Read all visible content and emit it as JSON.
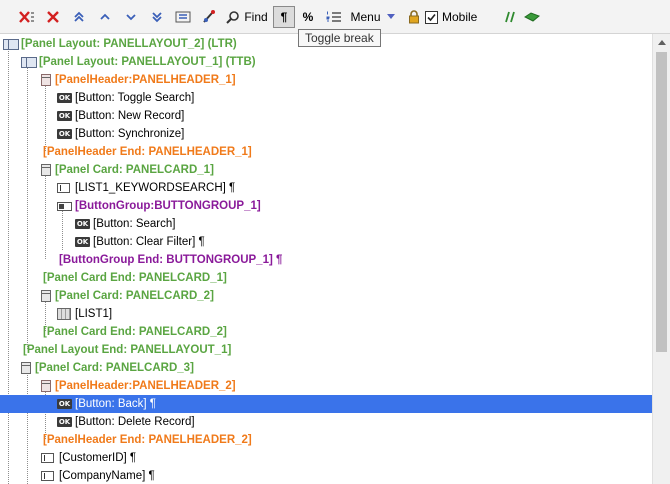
{
  "toolbar": {
    "find_label": "Find",
    "pilcrow_label": "¶",
    "percent_label": "%",
    "menu_label": "Menu",
    "mobile_label": "Mobile",
    "mobile_checked": true,
    "tooltip": "Toggle break"
  },
  "tree": {
    "rows": [
      {
        "text": "[Panel Layout: PANELLAYOUT_2] (LTR)",
        "color": "green",
        "icon": "layout-icon"
      },
      {
        "text": "[Panel Layout: PANELLAYOUT_1] (TTB)",
        "color": "green",
        "icon": "layout-icon"
      },
      {
        "text": "[PanelHeader:PANELHEADER_1]",
        "color": "orange",
        "icon": "panel-icon"
      },
      {
        "text": "[Button: Toggle Search]",
        "color": "black",
        "icon": "ok-button-icon"
      },
      {
        "text": "[Button: New Record]",
        "color": "black",
        "icon": "ok-button-icon"
      },
      {
        "text": "[Button: Synchronize]",
        "color": "black",
        "icon": "ok-button-icon"
      },
      {
        "text": "[PanelHeader End: PANELHEADER_1]",
        "color": "orange",
        "icon": ""
      },
      {
        "text": "[Panel Card: PANELCARD_1]",
        "color": "green",
        "icon": "panel-icon"
      },
      {
        "text": "[LIST1_KEYWORDSEARCH] ¶",
        "color": "black",
        "icon": "textbox-icon"
      },
      {
        "text": "[ButtonGroup:BUTTONGROUP_1]",
        "color": "purple",
        "icon": "button-group-icon"
      },
      {
        "text": "[Button: Search]",
        "color": "black",
        "icon": "ok-button-icon"
      },
      {
        "text": "[Button: Clear Filter] ¶",
        "color": "black",
        "icon": "ok-button-icon"
      },
      {
        "text": "[ButtonGroup End: BUTTONGROUP_1] ¶",
        "color": "purple",
        "icon": ""
      },
      {
        "text": "[Panel Card End: PANELCARD_1]",
        "color": "green",
        "icon": ""
      },
      {
        "text": "[Panel Card: PANELCARD_2]",
        "color": "green",
        "icon": "panel-icon"
      },
      {
        "text": "[LIST1]",
        "color": "black",
        "icon": "grid-icon"
      },
      {
        "text": "[Panel Card End: PANELCARD_2]",
        "color": "green",
        "icon": ""
      },
      {
        "text": "[Panel Layout End: PANELLAYOUT_1]",
        "color": "green",
        "icon": ""
      },
      {
        "text": "[Panel Card: PANELCARD_3]",
        "color": "green",
        "icon": "panel-icon"
      },
      {
        "text": "[PanelHeader:PANELHEADER_2]",
        "color": "orange",
        "icon": "panel-icon"
      },
      {
        "text": "[Button: Back] ¶",
        "color": "black",
        "icon": "ok-button-icon",
        "selected": true
      },
      {
        "text": "[Button: Delete Record]",
        "color": "black",
        "icon": "ok-button-icon"
      },
      {
        "text": "[PanelHeader End: PANELHEADER_2]",
        "color": "orange",
        "icon": ""
      },
      {
        "text": "[CustomerID] ¶",
        "color": "black",
        "icon": "textbox-icon"
      },
      {
        "text": "[CompanyName] ¶",
        "color": "black",
        "icon": "textbox-icon"
      }
    ],
    "ok_icon_text": "OK"
  }
}
